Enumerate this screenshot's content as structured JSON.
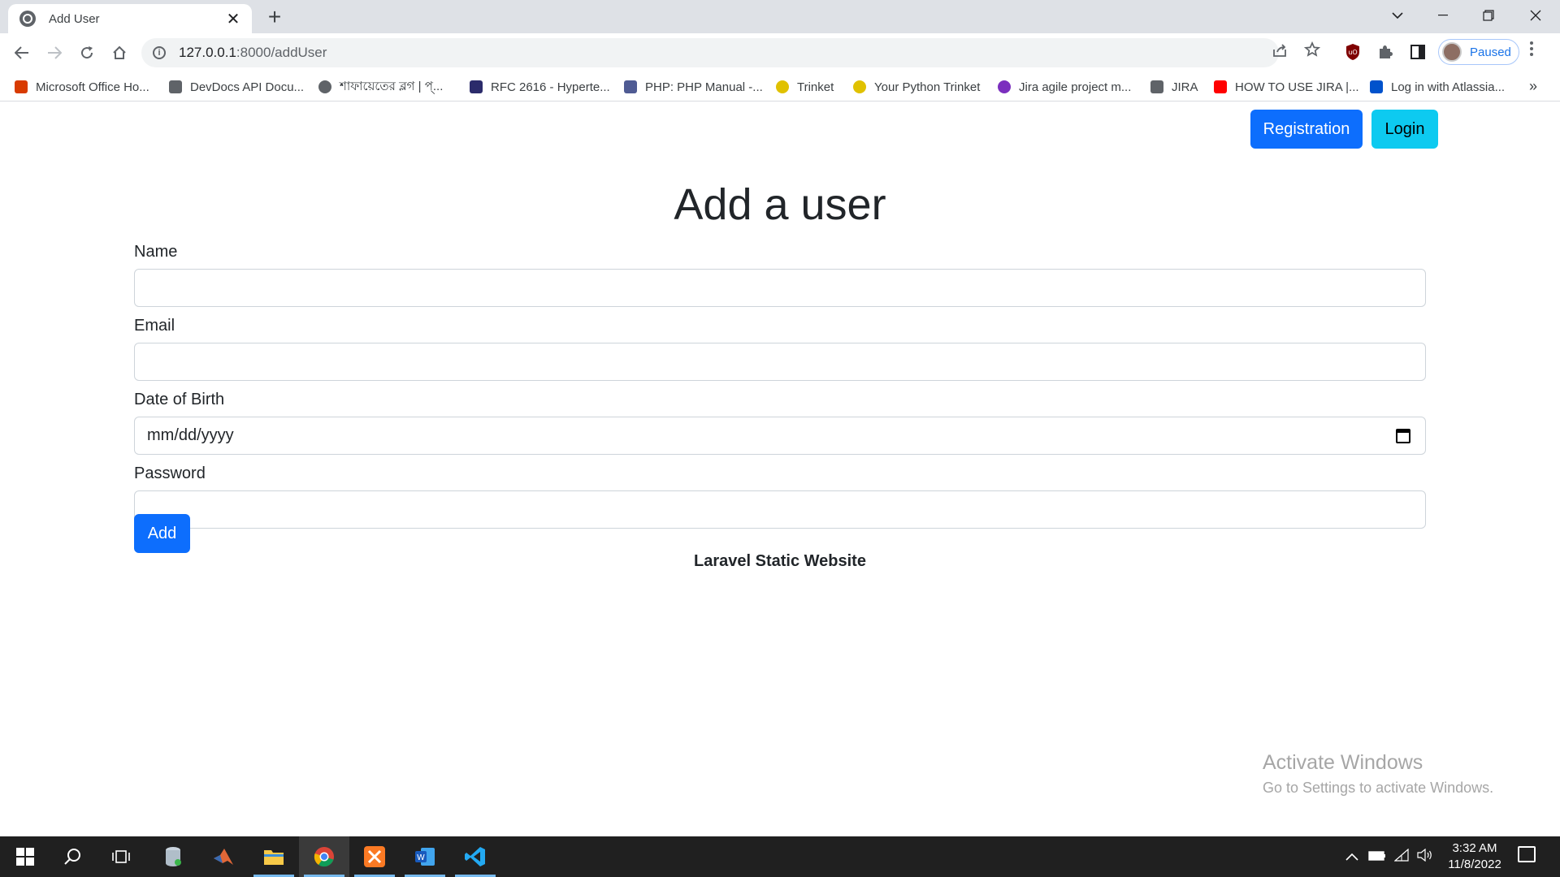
{
  "browser": {
    "tab_title": "Add User",
    "close_glyph": "✕",
    "new_tab_glyph": "+",
    "url_host": "127.0.0.1",
    "url_path": ":8000/addUser",
    "profile_label": "Paused",
    "bookmarks": [
      {
        "label": "Microsoft Office Ho...",
        "icon": "office-icon",
        "color": "#d83b01"
      },
      {
        "label": "DevDocs API Docu...",
        "icon": "devdocs-icon",
        "color": "#5f6368"
      },
      {
        "label": "শাফায়েতের ব্লগ | প্...",
        "icon": "globe-icon",
        "color": "#5f6368"
      },
      {
        "label": "RFC 2616 - Hyperte...",
        "icon": "rfc-icon",
        "color": "#2b2b6b"
      },
      {
        "label": "PHP: PHP Manual -...",
        "icon": "php-icon",
        "color": "#4f5b93"
      },
      {
        "label": "Trinket",
        "icon": "trinket-icon",
        "color": "#e0c100"
      },
      {
        "label": "Your Python Trinket",
        "icon": "trinket-icon",
        "color": "#e0c100"
      },
      {
        "label": "Jira agile project m...",
        "icon": "jira-icon",
        "color": "#7b2fbe"
      },
      {
        "label": "JIRA",
        "icon": "jira-diamond-icon",
        "color": "#5f6368"
      },
      {
        "label": "HOW TO USE JIRA |...",
        "icon": "youtube-icon",
        "color": "#ff0000"
      },
      {
        "label": "Log in with Atlassia...",
        "icon": "atlassian-icon",
        "color": "#0052cc"
      }
    ],
    "more_glyph": "»"
  },
  "page": {
    "nav": {
      "registration": "Registration",
      "login": "Login"
    },
    "heading": "Add a user",
    "form": {
      "name_label": "Name",
      "email_label": "Email",
      "dob_label": "Date of Birth",
      "dob_placeholder": "mm/dd/yyyy",
      "password_label": "Password",
      "submit_label": "Add"
    },
    "footer": "Laravel Static Website",
    "watermark_line1": "Activate Windows",
    "watermark_line2": "Go to Settings to activate Windows."
  },
  "taskbar": {
    "apps": [
      "start-icon",
      "search-icon",
      "task-view-icon",
      "db-icon",
      "matlab-icon",
      "file-explorer-icon",
      "chrome-icon",
      "xampp-icon",
      "word-icon",
      "vscode-icon"
    ],
    "time": "3:32 AM",
    "date": "11/8/2022"
  },
  "colors": {
    "primary": "#0d6efd",
    "info": "#0dcaf0",
    "taskbar": "#202020"
  }
}
